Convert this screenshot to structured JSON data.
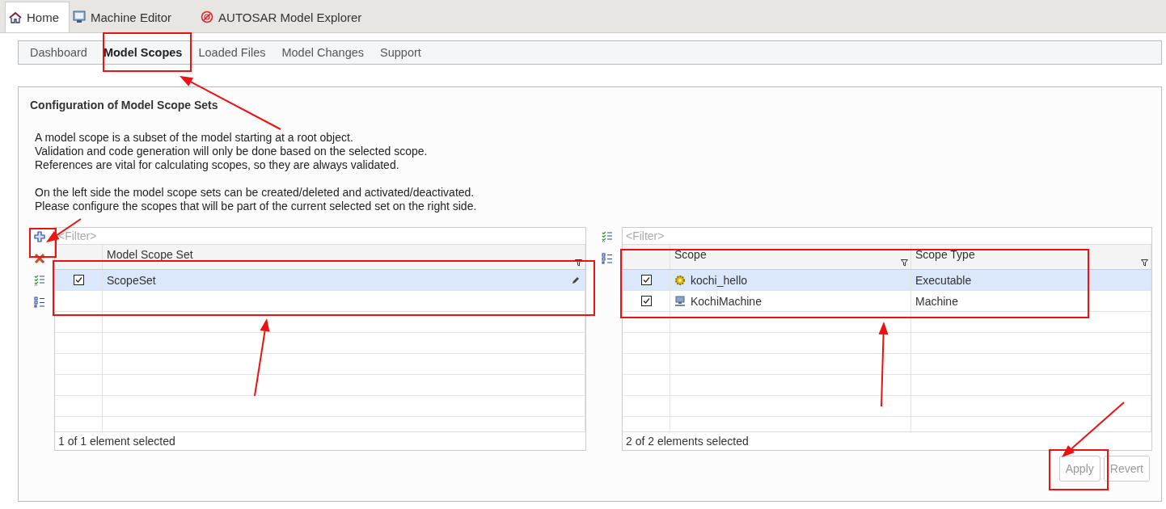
{
  "tabs": [
    {
      "label": "Home",
      "kind": "home",
      "selected": true
    },
    {
      "label": "Machine Editor",
      "kind": "machine",
      "selected": false
    },
    {
      "label": "AUTOSAR Model Explorer",
      "kind": "autosar",
      "selected": false
    }
  ],
  "sub_tabs": [
    {
      "label": "Dashboard",
      "selected": false
    },
    {
      "label": "Model Scopes",
      "selected": true
    },
    {
      "label": "Loaded Files",
      "selected": false
    },
    {
      "label": "Model Changes",
      "selected": false
    },
    {
      "label": "Support",
      "selected": false
    }
  ],
  "panel": {
    "title": "Configuration of Model Scope Sets",
    "paragraphs": [
      {
        "lines": [
          "A model scope is a subset of the model starting at a root object.",
          "Validation and code generation will only be done based on the selected scope.",
          "References are vital for calculating scopes, so they are always validated."
        ]
      },
      {
        "lines": [
          "On the left side the model scope sets can be created/deleted and activated/deactivated.",
          "Please configure the scopes that will be part of the current selected set on the right side."
        ]
      }
    ]
  },
  "left_table": {
    "toolbar": [
      {
        "kind": "add"
      },
      {
        "kind": "delete"
      },
      {
        "kind": "check-all"
      },
      {
        "kind": "uncheck-all"
      }
    ],
    "filter": {
      "placeholder": "<Filter>"
    },
    "columns": [
      "Model Scope Set"
    ],
    "rows": [
      {
        "checked": true,
        "selected": true,
        "cells": [
          "ScopeSet"
        ]
      }
    ],
    "status": "1 of 1 element selected"
  },
  "right_table": {
    "toolbar": [
      {
        "kind": "check-all"
      },
      {
        "kind": "uncheck-all"
      }
    ],
    "filter": {
      "placeholder": "<Filter>"
    },
    "columns": [
      "Scope",
      "Scope Type"
    ],
    "rows": [
      {
        "checked": true,
        "selected": true,
        "kind": "executable",
        "cells": [
          "kochi_hello",
          "Executable"
        ]
      },
      {
        "checked": true,
        "selected": false,
        "kind": "machine",
        "cells": [
          "KochiMachine",
          "Machine"
        ]
      }
    ],
    "status": "2 of 2 elements selected"
  },
  "buttons": [
    {
      "label": "Apply",
      "disabled": true
    },
    {
      "label": "Revert",
      "disabled": true
    }
  ]
}
